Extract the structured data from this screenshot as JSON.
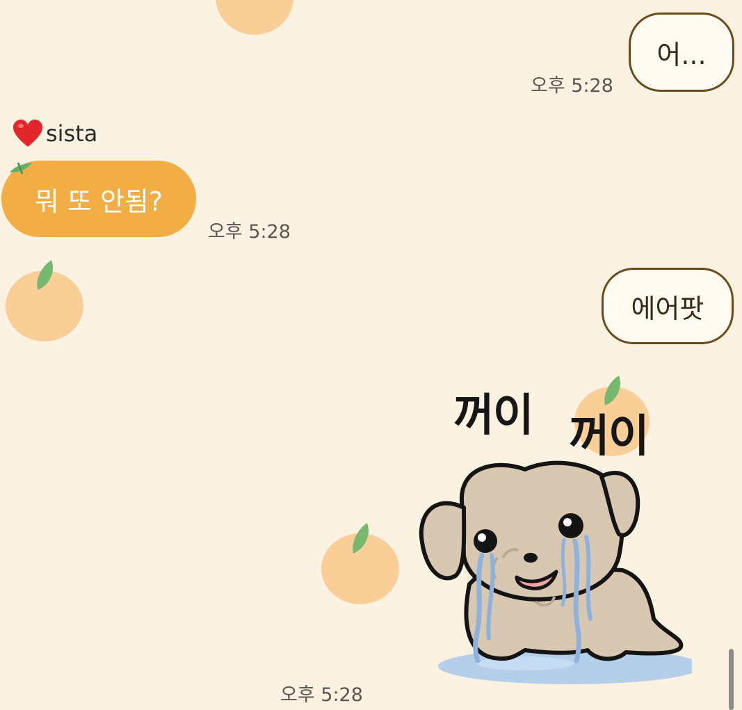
{
  "messages": [
    {
      "direction": "outgoing",
      "text": "어...",
      "time": "오후 5:28"
    },
    {
      "direction": "incoming",
      "sender": "sista",
      "text": "뭐 또 안됨?",
      "time": "오후 5:28"
    },
    {
      "direction": "outgoing",
      "text": "에어팟"
    },
    {
      "direction": "outgoing",
      "type": "sticker",
      "sticker_text": [
        "꺼이",
        "꺼이"
      ],
      "time": "오후 5:28"
    }
  ],
  "sender": {
    "name": "sista",
    "icon": "red-heart-icon"
  },
  "theme": {
    "background": "#fcf2e2",
    "incoming_bubble": "#f2ad44",
    "outgoing_bubble": "#fffaf2",
    "outgoing_border": "#6b4a1a",
    "decoration": "tangerine"
  }
}
